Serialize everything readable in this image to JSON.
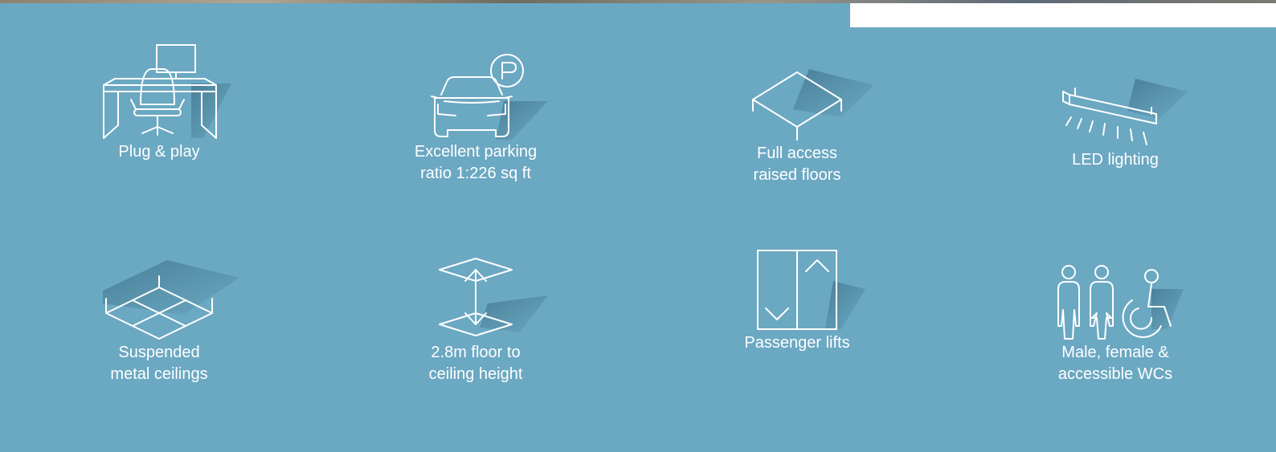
{
  "features": [
    {
      "icon": "desk-chair-icon",
      "lines": [
        "Plug & play"
      ]
    },
    {
      "icon": "car-parking-icon",
      "lines": [
        "Excellent parking",
        "ratio 1:226 sq ft"
      ]
    },
    {
      "icon": "raised-floor-icon",
      "lines": [
        "Full access",
        "raised floors"
      ]
    },
    {
      "icon": "led-light-icon",
      "lines": [
        "LED lighting"
      ]
    },
    {
      "icon": "ceiling-grid-icon",
      "lines": [
        "Suspended",
        "metal ceilings"
      ]
    },
    {
      "icon": "height-arrow-icon",
      "lines": [
        "2.8m floor to",
        "ceiling height"
      ]
    },
    {
      "icon": "lift-icon",
      "lines": [
        "Passenger lifts"
      ]
    },
    {
      "icon": "toilets-icon",
      "lines": [
        "Male, female &",
        "accessible WCs"
      ]
    }
  ],
  "colors": {
    "background": "#6ba8c2",
    "text": "#ffffff",
    "panel": "#ffffff"
  }
}
